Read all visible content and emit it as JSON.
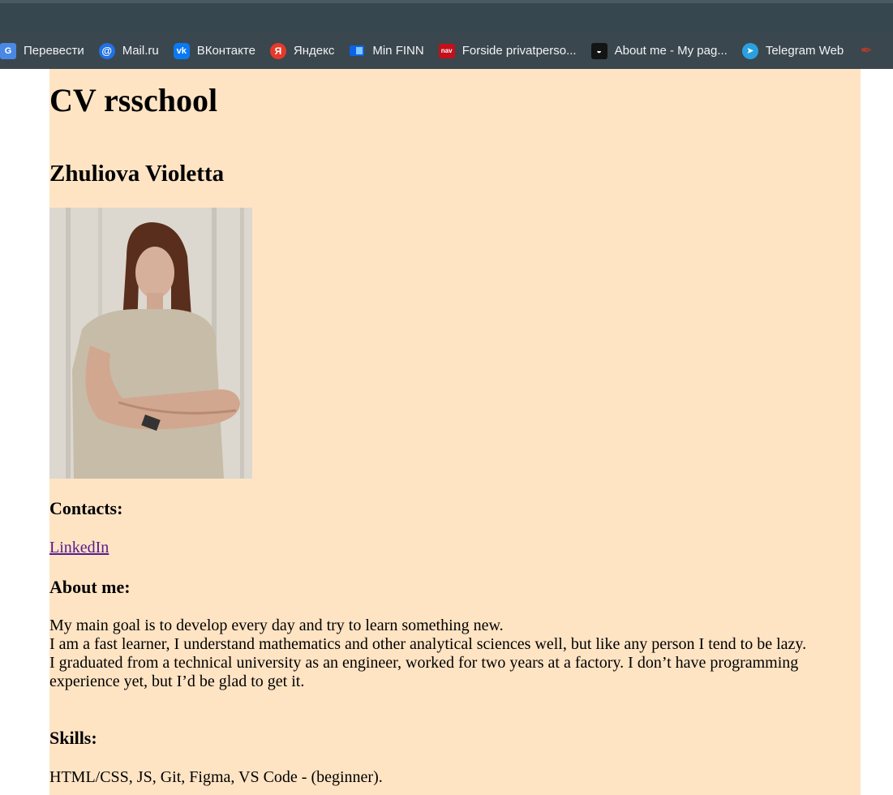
{
  "bookmarks": [
    {
      "label": "Перевести",
      "icon": "translate-icon",
      "glyph": "G"
    },
    {
      "label": "Mail.ru",
      "icon": "mail-icon",
      "glyph": "@"
    },
    {
      "label": "ВКонтакте",
      "icon": "vk-icon",
      "glyph": "vk"
    },
    {
      "label": "Яндекс",
      "icon": "yandex-icon",
      "glyph": "Я"
    },
    {
      "label": "Min FINN",
      "icon": "finn-icon",
      "glyph": ""
    },
    {
      "label": "Forside privatperso...",
      "icon": "nav-icon",
      "glyph": "nav"
    },
    {
      "label": "About me - My pag...",
      "icon": "about-icon",
      "glyph": "◒"
    },
    {
      "label": "Telegram Web",
      "icon": "telegram-icon",
      "glyph": "➤"
    },
    {
      "label": "",
      "icon": "feather-icon",
      "glyph": "✒"
    }
  ],
  "page": {
    "title": "CV rsschool",
    "name": "Zhuliova Violetta",
    "photo_alt": "Portrait photo",
    "contacts_heading": "Contacts:",
    "linkedin_label": "LinkedIn",
    "about_heading": "About me:",
    "about_lines": [
      "My main goal is to develop every day and try to learn something new.",
      "I am a fast learner, I understand mathematics and other analytical sciences well, but like any person I tend to be lazy.",
      "I graduated from a technical university as an engineer, worked for two years at a factory. I don’t have programming experience yet, but I’d be glad to get it."
    ],
    "skills_heading": "Skills:",
    "skills_text": "HTML/CSS, JS, Git, Figma, VS Code - (beginner)."
  },
  "colors": {
    "page_background": "#ffe4c4",
    "browser_frame": "#37474f",
    "bookmark_bar": "#3b474e",
    "visited_link": "#551a8b"
  }
}
